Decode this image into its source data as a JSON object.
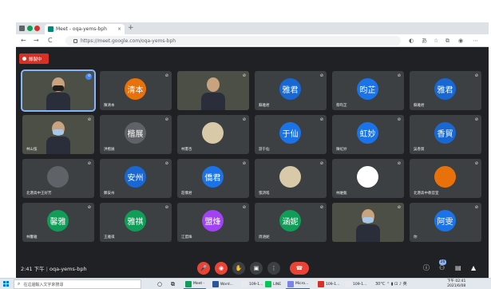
{
  "browser": {
    "tab_title": "Meet - oqa-yems-bph",
    "tab_close": "×",
    "new_tab": "+",
    "url": "https://meet.google.com/oqa-yems-bph",
    "nav_back": "←",
    "nav_forward": "→",
    "nav_reload": "C",
    "nav_home": "⌂"
  },
  "meet": {
    "recording_label": "錄製中",
    "meeting_time": "2:41 下午",
    "meeting_code": "oqa-yems-bph",
    "participant_count": "26",
    "colors": {
      "background": "#202124",
      "tile": "#3c4043",
      "end_call": "#ea4335"
    },
    "tiles": [
      {
        "type": "video",
        "name": "",
        "mask": "black",
        "active": true
      },
      {
        "type": "avatar",
        "initials": "清本",
        "color": "#e8710a",
        "name": "陳清本"
      },
      {
        "type": "video",
        "name": "",
        "mask": "none"
      },
      {
        "type": "avatar",
        "initials": "雅君",
        "color": "#1967d2",
        "name": "蘇雅君"
      },
      {
        "type": "avatar",
        "initials": "昀芷",
        "color": "#1a73e8",
        "name": "蔡昀芷"
      },
      {
        "type": "avatar",
        "initials": "雅君",
        "color": "#1967d2",
        "name": "蘇雅君"
      },
      {
        "type": "video",
        "name": "林山弦",
        "mask": "blue"
      },
      {
        "type": "avatar",
        "initials": "楷展",
        "color": "#5f6368",
        "name": "洪楷展"
      },
      {
        "type": "avatar",
        "initials": "",
        "color": "#d8c9a8",
        "name": "林憲杏",
        "pic": true
      },
      {
        "type": "avatar",
        "initials": "于仙",
        "color": "#1a73e8",
        "name": "游于仙"
      },
      {
        "type": "avatar",
        "initials": "虹妙",
        "color": "#1a73e8",
        "name": "陳虹妙"
      },
      {
        "type": "avatar",
        "initials": "香貿",
        "color": "#1967d2",
        "name": "吳香貿"
      },
      {
        "type": "avatar",
        "initials": "",
        "color": "#5f6368",
        "name": "北港高中王好芳",
        "pic": true
      },
      {
        "type": "avatar",
        "initials": "安州",
        "color": "#1967d2",
        "name": "鄭安州"
      },
      {
        "type": "avatar",
        "initials": "僑君",
        "color": "#1a73e8",
        "name": "莊僑君"
      },
      {
        "type": "avatar",
        "initials": "",
        "color": "#d8c9a8",
        "name": "張詩瑤",
        "pic": true
      },
      {
        "type": "avatar",
        "initials": "",
        "color": "#ffffff",
        "name": "林維甄",
        "pic": true
      },
      {
        "type": "avatar",
        "initials": "",
        "color": "#e8710a",
        "name": "北港高中教官室",
        "pic": true
      },
      {
        "type": "avatar",
        "initials": "馨雅",
        "color": "#0f9d58",
        "name": "林馨雅"
      },
      {
        "type": "avatar",
        "initials": "雅祺",
        "color": "#0f9d58",
        "name": "王雅祺"
      },
      {
        "type": "avatar",
        "initials": "盟烽",
        "color": "#a142f4",
        "name": "江盟烽"
      },
      {
        "type": "avatar",
        "initials": "涵妮",
        "color": "#0f9d58",
        "name": "周涵妮"
      },
      {
        "type": "video",
        "name": "",
        "mask": "blue"
      },
      {
        "type": "avatar",
        "initials": "阿雯",
        "color": "#1a73e8",
        "name": "你"
      }
    ],
    "controls": {
      "mic": "mic-off",
      "camera": "camera-off",
      "raise_hand": "✋",
      "present": "▣",
      "more": "⋮",
      "end_call": "☎"
    },
    "right_icons": [
      "ⓘ",
      "👥",
      "💬",
      "▲"
    ]
  },
  "taskbar": {
    "search_placeholder": "在這邊輸入文字來搜尋",
    "apps": [
      {
        "label": "Meet -",
        "color": "#0f9d58"
      },
      {
        "label": "Word...",
        "color": "#2b579a"
      },
      {
        "label": "109-1...",
        "color": "#e8eaed"
      },
      {
        "label": "LINE",
        "color": "#06c755"
      },
      {
        "label": "Micro...",
        "color": "#7b83eb"
      },
      {
        "label": "109-1...",
        "color": "#d93025"
      },
      {
        "label": "109-1...",
        "color": "#e8eaed"
      }
    ],
    "tray": "30°C  ⌃ ▮ ⊡ ♪ 英",
    "clock_time": "下午 02:41",
    "clock_date": "2021/6/08"
  }
}
